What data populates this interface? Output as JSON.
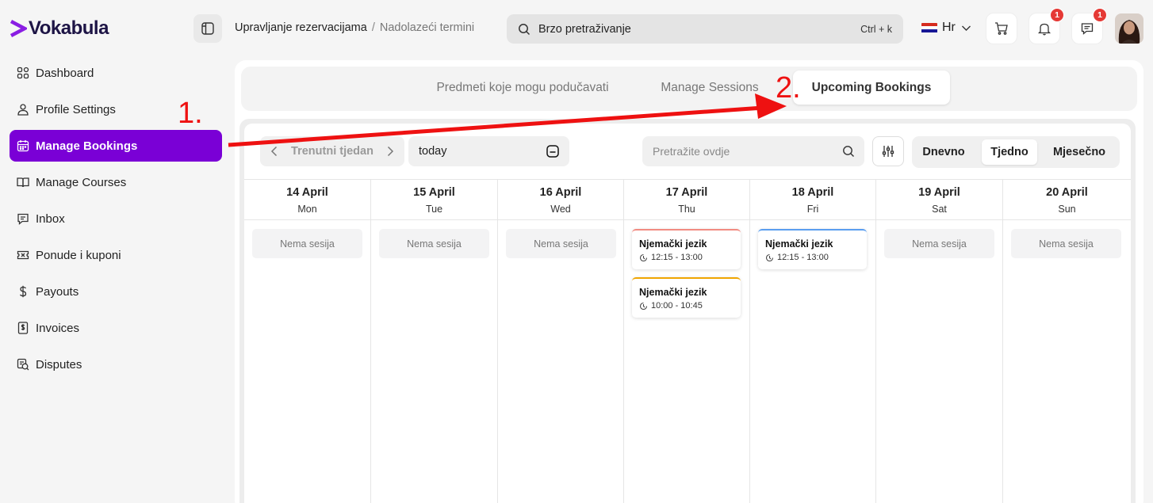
{
  "app": {
    "brand": "Vokabula"
  },
  "sidebar": {
    "items": [
      {
        "label": "Dashboard",
        "icon": "dashboard-icon",
        "active": false
      },
      {
        "label": "Profile Settings",
        "icon": "user-icon",
        "active": false
      },
      {
        "label": "Manage Bookings",
        "icon": "calendar-icon",
        "active": true
      },
      {
        "label": "Manage Courses",
        "icon": "book-icon",
        "active": false
      },
      {
        "label": "Inbox",
        "icon": "message-icon",
        "active": false
      },
      {
        "label": "Ponude i kuponi",
        "icon": "coupon-icon",
        "active": false
      },
      {
        "label": "Payouts",
        "icon": "dollar-icon",
        "active": false
      },
      {
        "label": "Invoices",
        "icon": "invoice-icon",
        "active": false
      },
      {
        "label": "Disputes",
        "icon": "dispute-icon",
        "active": false
      }
    ]
  },
  "header": {
    "breadcrumb": {
      "current": "Upravljanje rezervacijama",
      "separator": "/",
      "sub": "Nadolazeći termini"
    },
    "search": {
      "placeholder": "Brzo pretraživanje",
      "shortcut": "Ctrl + k"
    },
    "language": "Hr",
    "notifications_count": "1",
    "messages_count": "1"
  },
  "tabs": [
    {
      "label": "Predmeti koje mogu podučavati",
      "active": false
    },
    {
      "label": "Manage Sessions",
      "active": false
    },
    {
      "label": "Upcoming Bookings",
      "active": true
    }
  ],
  "calendar": {
    "week_label": "Trenutni tjedan",
    "date_value": "today",
    "search_placeholder": "Pretražite ovdje",
    "views": [
      {
        "label": "Dnevno",
        "active": false
      },
      {
        "label": "Tjedno",
        "active": true
      },
      {
        "label": "Mjesečno",
        "active": false
      }
    ],
    "days": [
      {
        "date": "14 April",
        "weekday": "Mon",
        "empty_text": "Nema sesija",
        "events": []
      },
      {
        "date": "15 April",
        "weekday": "Tue",
        "empty_text": "Nema sesija",
        "events": []
      },
      {
        "date": "16 April",
        "weekday": "Wed",
        "empty_text": "Nema sesija",
        "events": []
      },
      {
        "date": "17 April",
        "weekday": "Thu",
        "empty_text": "",
        "events": [
          {
            "title": "Njemački jezik",
            "time": "12:15 - 13:00",
            "color": "#f28b82"
          },
          {
            "title": "Njemački jezik",
            "time": "10:00 - 10:45",
            "color": "#f0a500"
          }
        ]
      },
      {
        "date": "18 April",
        "weekday": "Fri",
        "empty_text": "",
        "events": [
          {
            "title": "Njemački jezik",
            "time": "12:15 - 13:00",
            "color": "#5b9ef0"
          }
        ]
      },
      {
        "date": "19 April",
        "weekday": "Sat",
        "empty_text": "Nema sesija",
        "events": []
      },
      {
        "date": "20 April",
        "weekday": "Sun",
        "empty_text": "Nema sesija",
        "events": []
      }
    ]
  },
  "annotations": {
    "step1": "1.",
    "step2": "2.",
    "color": "#ee1111"
  },
  "colors": {
    "accent": "#7a00d6",
    "badge": "#e53935"
  }
}
